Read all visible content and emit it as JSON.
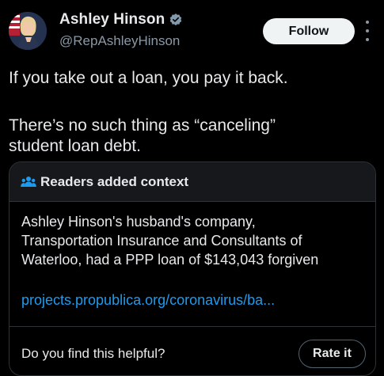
{
  "author": {
    "display_name": "Ashley Hinson",
    "handle": "@RepAshleyHinson",
    "verified_icon": "verified-badge-icon",
    "follow_label": "Follow"
  },
  "tweet": {
    "lines": [
      "If you take out a loan, you pay it back.",
      "There’s no such thing as “canceling”",
      "student loan debt."
    ]
  },
  "note": {
    "icon": "people-icon",
    "title": "Readers added context",
    "lines": [
      "Ashley Hinson's husband's company,",
      "Transportation Insurance and Consultants of",
      "Waterloo, had a PPP loan of $143,043 forgiven"
    ],
    "link": "projects.propublica.org/coronavirus/ba...",
    "helpful_question": "Do you find this helpful?",
    "rate_label": "Rate it"
  },
  "colors": {
    "background": "#000000",
    "text": "#e7e9ea",
    "secondary": "#8b98a5",
    "link": "#1d9bf0",
    "border": "#2f3336",
    "verified": "#829aab"
  }
}
